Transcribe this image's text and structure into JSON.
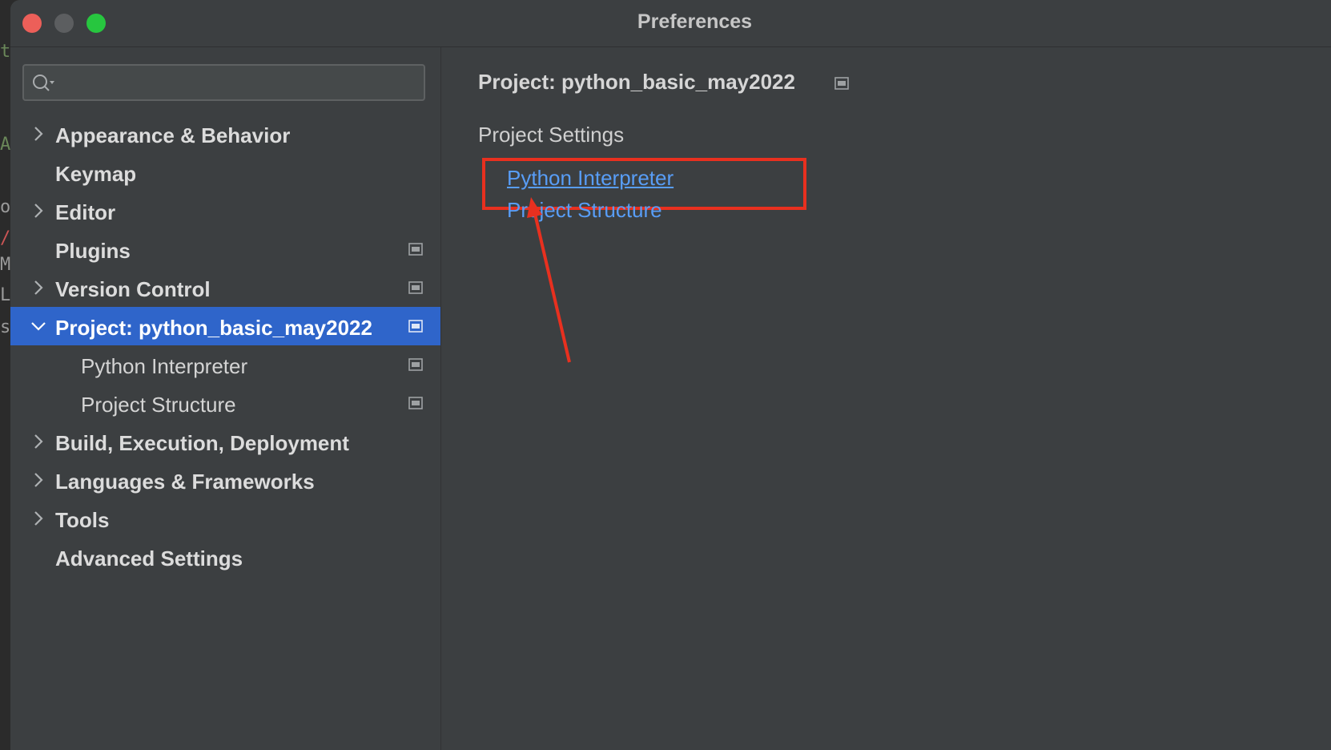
{
  "window": {
    "title": "Preferences",
    "traffic_lights": [
      "close",
      "minimize",
      "maximize"
    ]
  },
  "search": {
    "value": "",
    "placeholder": "",
    "icon": "search-icon"
  },
  "sidebar": {
    "items": [
      {
        "label": "Appearance & Behavior",
        "expandable": true,
        "expanded": false,
        "project_icon": false
      },
      {
        "label": "Keymap",
        "expandable": false,
        "project_icon": false
      },
      {
        "label": "Editor",
        "expandable": true,
        "expanded": false,
        "project_icon": false
      },
      {
        "label": "Plugins",
        "expandable": false,
        "project_icon": true
      },
      {
        "label": "Version Control",
        "expandable": true,
        "expanded": false,
        "project_icon": true
      },
      {
        "label": "Project: python_basic_may2022",
        "expandable": true,
        "expanded": true,
        "selected": true,
        "project_icon": true
      },
      {
        "label": "Python Interpreter",
        "child": true,
        "project_icon": true
      },
      {
        "label": "Project Structure",
        "child": true,
        "project_icon": true
      },
      {
        "label": "Build, Execution, Deployment",
        "expandable": true,
        "expanded": false,
        "project_icon": false
      },
      {
        "label": "Languages & Frameworks",
        "expandable": true,
        "expanded": false,
        "project_icon": false
      },
      {
        "label": "Tools",
        "expandable": true,
        "expanded": false,
        "project_icon": false
      },
      {
        "label": "Advanced Settings",
        "expandable": false,
        "project_icon": false
      }
    ]
  },
  "content": {
    "title": "Project: python_basic_may2022",
    "section": "Project Settings",
    "links": [
      "Python Interpreter",
      "Project Structure"
    ]
  },
  "colors": {
    "background": "#3c3f41",
    "selection": "#2f65ca",
    "link": "#589df6",
    "annotation": "#e8301f"
  }
}
